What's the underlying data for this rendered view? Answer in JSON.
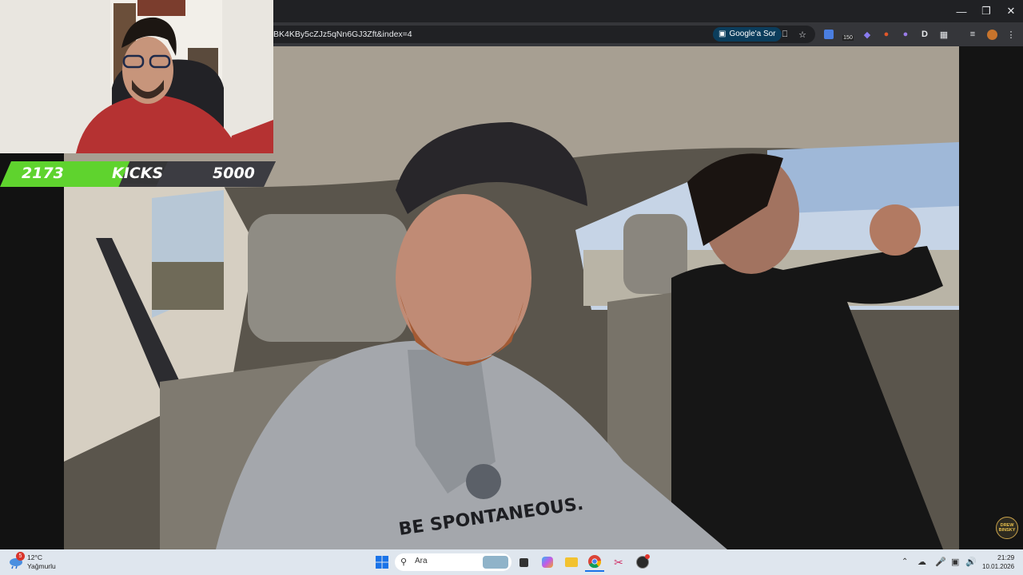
{
  "browser": {
    "url": "BK4KBy5cZJz5qNn6GJ3Zft&index=4",
    "ask_google_label": "Google'a Sor",
    "extension_badge": "150"
  },
  "stream_overlay": {
    "kicks_current": "2173",
    "kicks_label": "KICKS",
    "kicks_goal": "5000",
    "progress": 0.43,
    "accent_color": "#5fd32e"
  },
  "video": {
    "shirt_text": "BE SPONTANEOUS.",
    "channel_logo": "DREW BINSKY"
  },
  "taskbar": {
    "weather_badge": "5",
    "weather_temp": "12°C",
    "weather_desc": "Yağmurlu",
    "search_placeholder": "Ara",
    "time": "21:29",
    "date": "10.01.2026",
    "background": "#dfe6ee"
  }
}
